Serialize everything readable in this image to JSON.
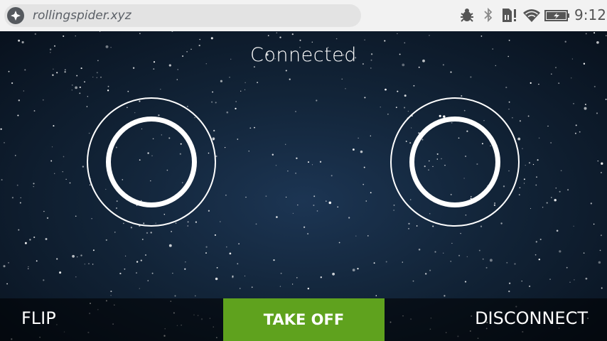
{
  "browser": {
    "url": "rollingspider.xyz",
    "site_icon": "pin-icon"
  },
  "status_bar": {
    "icons": [
      "bug-icon",
      "bluetooth-icon",
      "sim-card-alert-icon",
      "wifi-icon",
      "battery-charging-icon"
    ],
    "time": "9:12"
  },
  "app": {
    "connection_status": "Connected",
    "left_joystick": "joystick-left",
    "right_joystick": "joystick-right",
    "flip_label": "FLIP",
    "takeoff_label": "TAKE OFF",
    "disconnect_label": "DISCONNECT"
  },
  "colors": {
    "accent": "#5fa21e",
    "status_bar_bg": "#f2f2f2",
    "text": "#ffffff"
  }
}
